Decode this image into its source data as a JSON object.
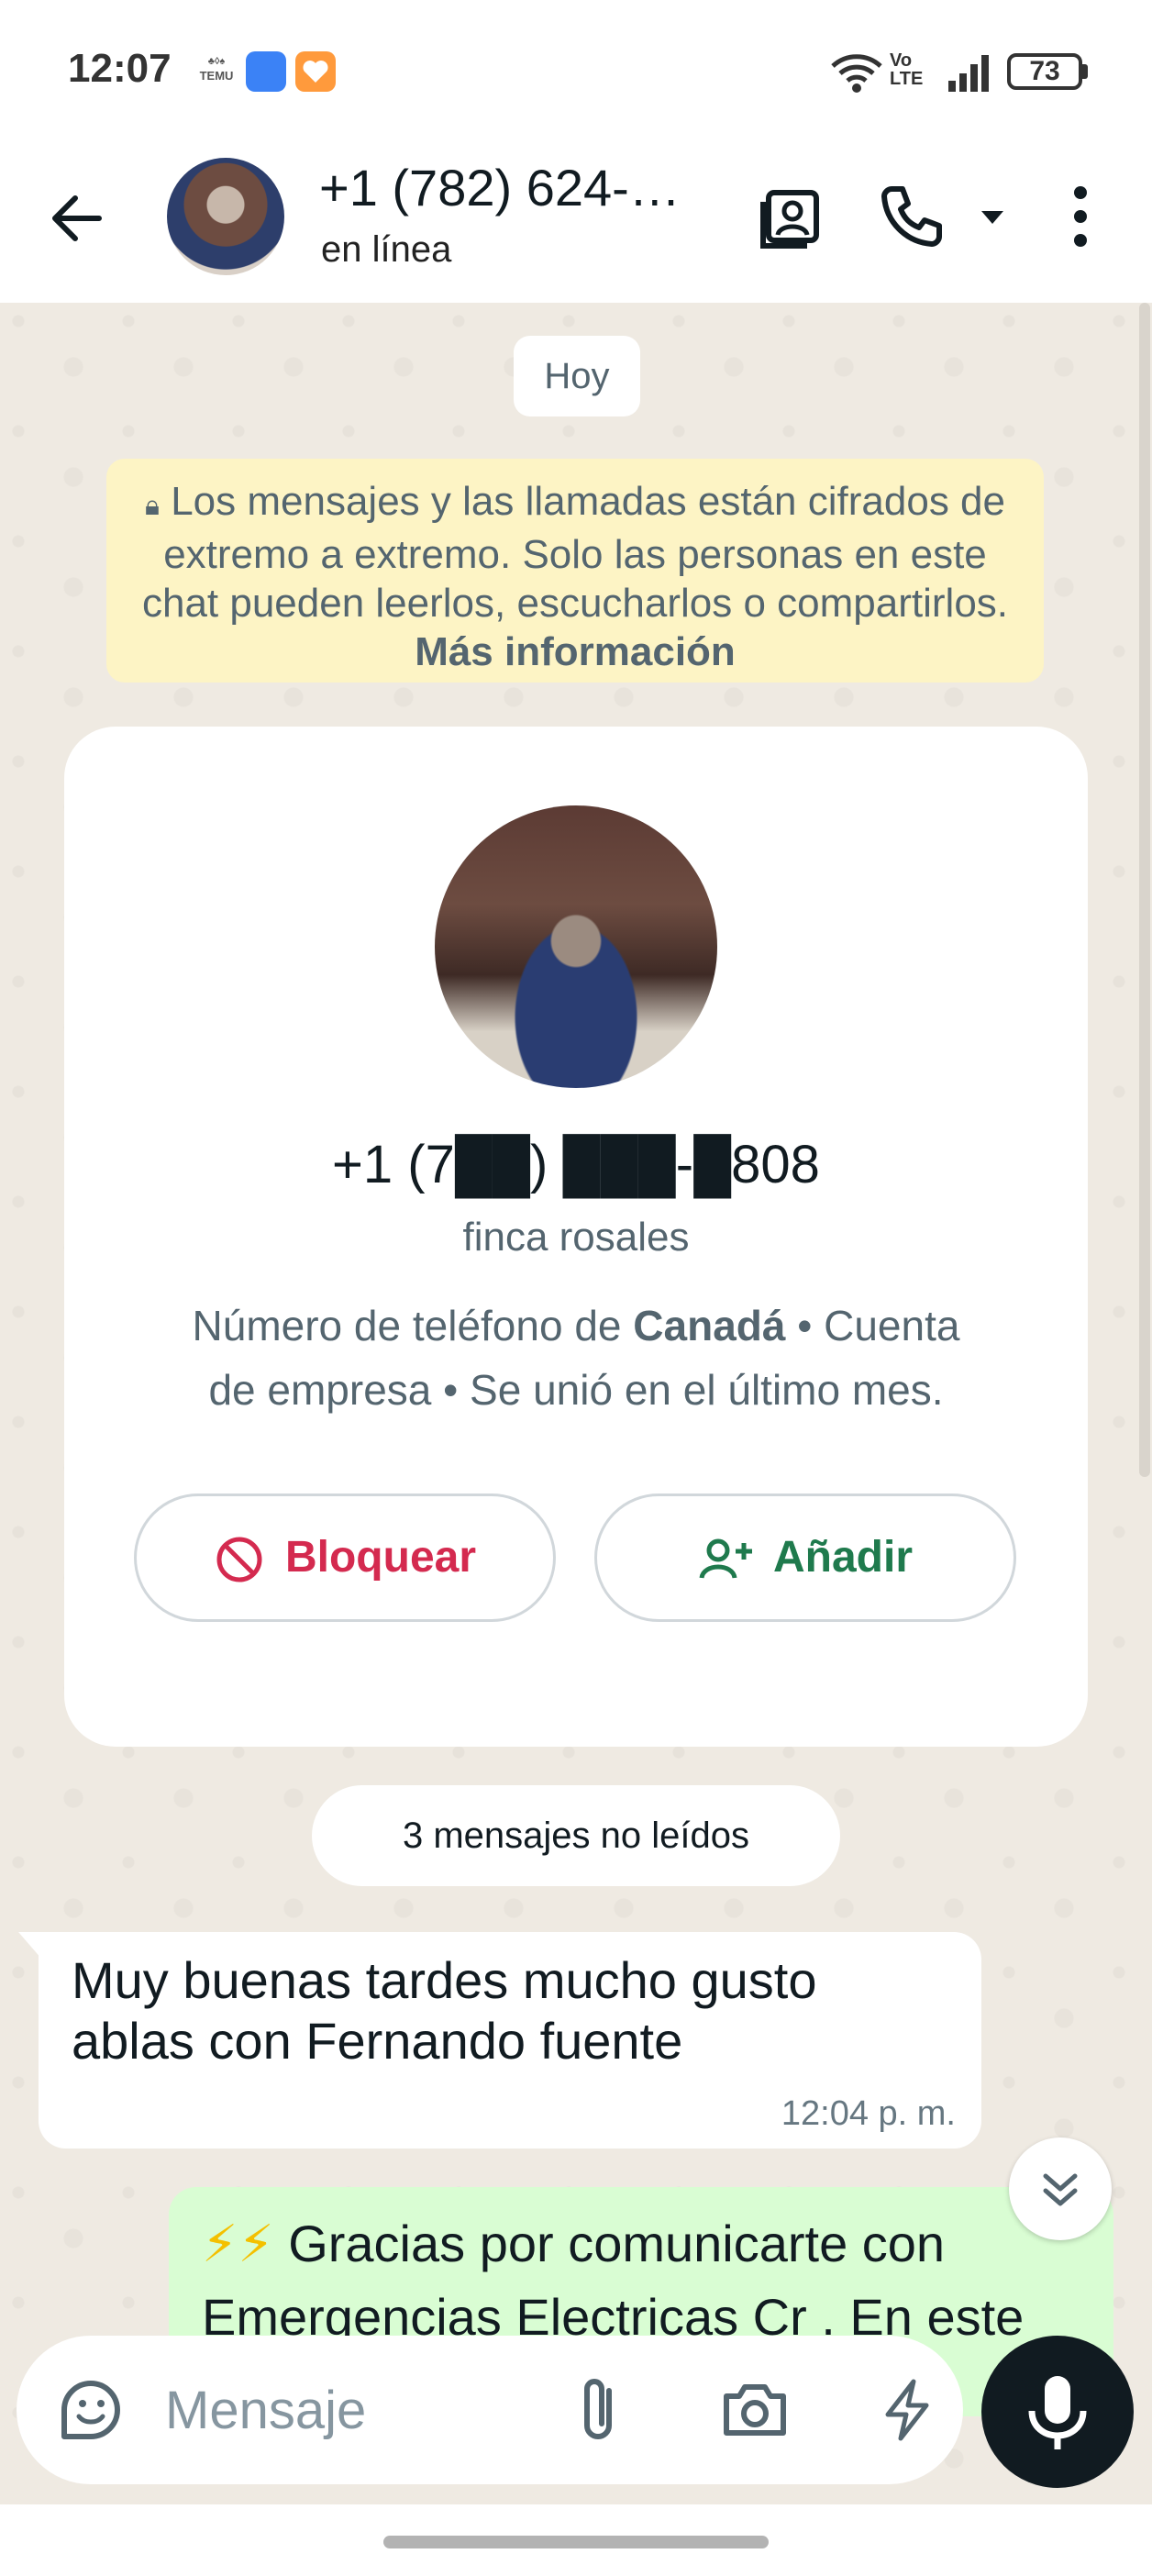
{
  "status_bar": {
    "time": "12:07",
    "temu_label": "TEMU",
    "battery": "73",
    "volte": "Vo LTE"
  },
  "header": {
    "title": "+1 (782) 624-…",
    "subtitle": "en línea"
  },
  "chat": {
    "date_chip": "Hoy",
    "encryption_text": "Los mensajes y las llamadas están cifrados de extremo a extremo. Solo las personas en este chat pueden leerlos, escucharlos o compartirlos.",
    "encryption_link": "Más información",
    "contact_card": {
      "phone": "+1 (7██) ███-█808",
      "name": "finca rosales",
      "desc_prefix": "Número de teléfono de ",
      "desc_country": "Canadá",
      "desc_suffix": " • Cuenta de empresa • Se unió en el último mes.",
      "block_label": "Bloquear",
      "add_label": "Añadir"
    },
    "unread_chip": "3 mensajes no leídos",
    "messages": [
      {
        "direction": "in",
        "text": "Muy buenas tardes mucho gusto ablas con Fernando fuente",
        "time": "12:04 p. m."
      },
      {
        "direction": "out",
        "text": "Gracias por comunicarte con Emergencias Electricas Cr . En este"
      }
    ]
  },
  "composer": {
    "placeholder": "Mensaje"
  },
  "colors": {
    "chat_bg": "#efeae2",
    "outgoing_bubble": "#d9fdd3",
    "encryption_bg": "#fdf4c5",
    "block_red": "#d42a4f",
    "add_green": "#1f7a4d"
  }
}
